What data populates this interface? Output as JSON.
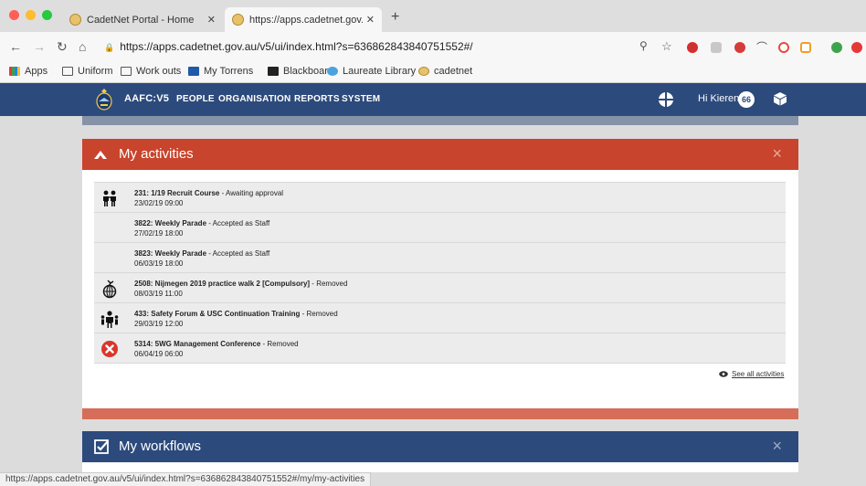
{
  "browser": {
    "tabs": [
      {
        "title": "CadetNet Portal - Home",
        "active": false
      },
      {
        "title": "https://apps.cadetnet.gov.au/v",
        "active": true
      }
    ],
    "url": "https://apps.cadetnet.gov.au/v5/ui/index.html?s=636862843840751552#/",
    "bookmarks": [
      "Apps",
      "Uniform",
      "Work outs",
      "My Torrens",
      "Blackboard",
      "Laureate Library",
      "cadetnet"
    ],
    "status_url": "https://apps.cadetnet.gov.au/v5/ui/index.html?s=636862843840751552#/my/my-activities"
  },
  "app": {
    "name": "AAFC:V5",
    "menu": [
      "PEOPLE",
      "ORGANISATION",
      "REPORTS",
      "SYSTEM"
    ],
    "greeting": "Hi Kieren",
    "badge_count": "66"
  },
  "activities_panel": {
    "title": "My activities",
    "close": "×",
    "items": [
      {
        "code_title": "231: 1/19 Recruit Course",
        "status": " - Awaiting approval",
        "datetime": "23/02/19 09:00",
        "icon": "people-icon"
      },
      {
        "code_title": "3822: Weekly Parade",
        "status": " - Accepted as Staff",
        "datetime": "27/02/19 18:00",
        "icon": "none"
      },
      {
        "code_title": "3823: Weekly Parade",
        "status": " - Accepted as Staff",
        "datetime": "06/03/19 18:00",
        "icon": "none"
      },
      {
        "code_title": "2508: Nijmegen 2019 practice walk 2 [Compulsory]",
        "status": " - Removed",
        "datetime": "08/03/19 11:00",
        "icon": "globe-walk-icon"
      },
      {
        "code_title": "433: Safety Forum & USC Continuation Training",
        "status": " - Removed",
        "datetime": "29/03/19 12:00",
        "icon": "group-icon"
      },
      {
        "code_title": "5314: 5WG Management Conference",
        "status": " - Removed",
        "datetime": "06/04/19 06:00",
        "icon": "cancel-icon"
      }
    ],
    "see_all": "See all activities"
  },
  "workflows_panel": {
    "title": "My workflows",
    "close": "×"
  },
  "colors": {
    "header_blue": "#2c4a7c",
    "activities_red": "#c9442c",
    "removed_red": "#d9362b"
  }
}
